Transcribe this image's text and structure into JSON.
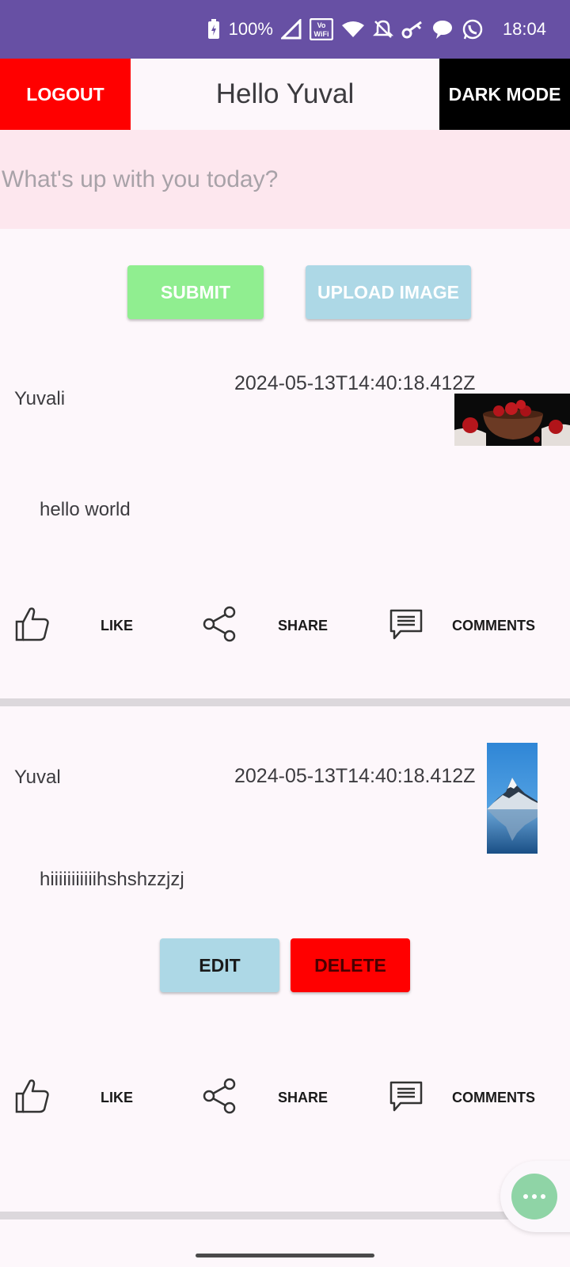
{
  "status_bar": {
    "battery": "100%",
    "time": "18:04",
    "icons": [
      "battery-charging-icon",
      "signal-icon",
      "vowifi-icon",
      "wifi-icon",
      "mute-icon",
      "key-icon",
      "chat-icon",
      "whatsapp-icon"
    ]
  },
  "header": {
    "logout_label": "LOGOUT",
    "greeting": "Hello Yuval",
    "dark_mode_label": "DARK MODE"
  },
  "composer": {
    "placeholder": "What's up with you today?",
    "value": ""
  },
  "composer_actions": {
    "submit_label": "SUBMIT",
    "upload_label": "UPLOAD IMAGE"
  },
  "posts": [
    {
      "author": "Yuvali",
      "timestamp": "2024-05-13T14:40:18.412Z",
      "content": "hello world",
      "image": "pomegranate-bowl-image",
      "actions": {
        "like": "LIKE",
        "share": "SHARE",
        "comments": "COMMENTS"
      }
    },
    {
      "author": "Yuval",
      "timestamp": "2024-05-13T14:40:18.412Z",
      "content": "hiiiiiiiiiiihshshzzjzj",
      "image": "mountain-lake-image",
      "edit_label": "EDIT",
      "delete_label": "DELETE",
      "actions": {
        "like": "LIKE",
        "share": "SHARE",
        "comments": "COMMENTS"
      }
    }
  ],
  "colors": {
    "status_bar": "#6750a4",
    "logout": "#ff0000",
    "dark_mode": "#000000",
    "submit": "#90ee90",
    "upload": "#add8e6",
    "delete": "#ff0000",
    "fab": "#8fd4a6"
  }
}
